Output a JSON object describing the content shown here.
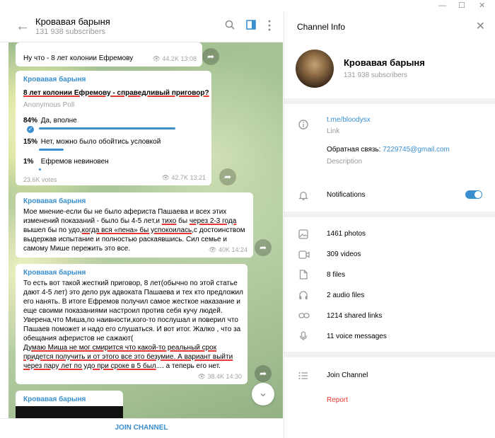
{
  "window": {
    "minimize": "—",
    "maximize": "☐",
    "close": "✕"
  },
  "header": {
    "title": "Кровавая барыня",
    "subtitle": "131 938 subscribers"
  },
  "messages": [
    {
      "text": "Ну что - 8 лет колонии Ефремову",
      "views": "44.2K",
      "time": "13:08"
    },
    {
      "name": "Кровавая барыня",
      "question": "8 лет колонии Ефремову - справедливый приговор?",
      "kind": "Anonymous Poll",
      "options": [
        {
          "pct": "84%",
          "label": "Да, вполне",
          "fill": 0.84
        },
        {
          "pct": "15%",
          "label": "Нет, можно было обойтись условкой",
          "fill": 0.15
        },
        {
          "pct": "1%",
          "label": "Ефремов невиновен",
          "fill": 0.01
        }
      ],
      "votes": "23.6K votes",
      "views": "42.7K",
      "time": "13:21"
    },
    {
      "name": "Кровавая барыня",
      "p1": "Мое мнение-если бы не было афериста Пашаева и всех этих изменений показаний - было бы 4-5 лет,и ",
      "u1": "тихо",
      "p2": " бы ",
      "u2": "через 2-3 года",
      "p3": " вышел бы по удо,",
      "u3": "когда вся «пена» бы успокоилась",
      "p4": ",с достоинством выдержав испытание и полностью раскаявшись. Сил семье и самому Мише пережить это все.",
      "views": "40K",
      "time": "14:24"
    },
    {
      "name": "Кровавая барыня",
      "p1": "То есть вот такой жесткий приговор, 8 лет(обычно по этой статье дают 4-5 лет) это дело рук адвоката Пашаева и тех кто предложил его нанять. В итоге Ефремов получил самое жесткое наказание и еще  своими показаниями настроил против себя кучу людей. Уверена,что Миша,по наивности,кого-то послушал и поверил что Пашаев поможет и надо его слушаться.  И вот итог. Жалко , что за обещания аферистов не сажают(",
      "u1": "Думаю Миша не мог смирится что какой-то реальный срок придется получить и от этого все это безумие. А вариант выйти через пару лет по удо при сроке в 5 был",
      "p2": ".... а теперь его нет.",
      "views": "38.4K",
      "time": "14:30"
    },
    {
      "name": "Кровавая барыня"
    }
  ],
  "join": "JOIN CHANNEL",
  "info": {
    "title": "Channel Info",
    "name": "Кровавая барыня",
    "subscribers": "131 938 subscribers",
    "link": "t.me/bloodysx",
    "link_label": "Link",
    "feedback_prefix": "Обратная связь: ",
    "feedback_email": "7229745@gmail.com",
    "description_label": "Description",
    "notifications": "Notifications",
    "notifications_on": true,
    "media": [
      {
        "icon": "photo-icon",
        "label": "1461 photos"
      },
      {
        "icon": "video-icon",
        "label": "309 videos"
      },
      {
        "icon": "file-icon",
        "label": "8 files"
      },
      {
        "icon": "headphones-icon",
        "label": "2 audio files"
      },
      {
        "icon": "link-icon",
        "label": "1214 shared links"
      },
      {
        "icon": "mic-icon",
        "label": "11 voice messages"
      }
    ],
    "join": "Join Channel",
    "report": "Report"
  },
  "colors": {
    "accent": "#3a8fcf",
    "underline": "#e53935",
    "report": "#e53935"
  }
}
